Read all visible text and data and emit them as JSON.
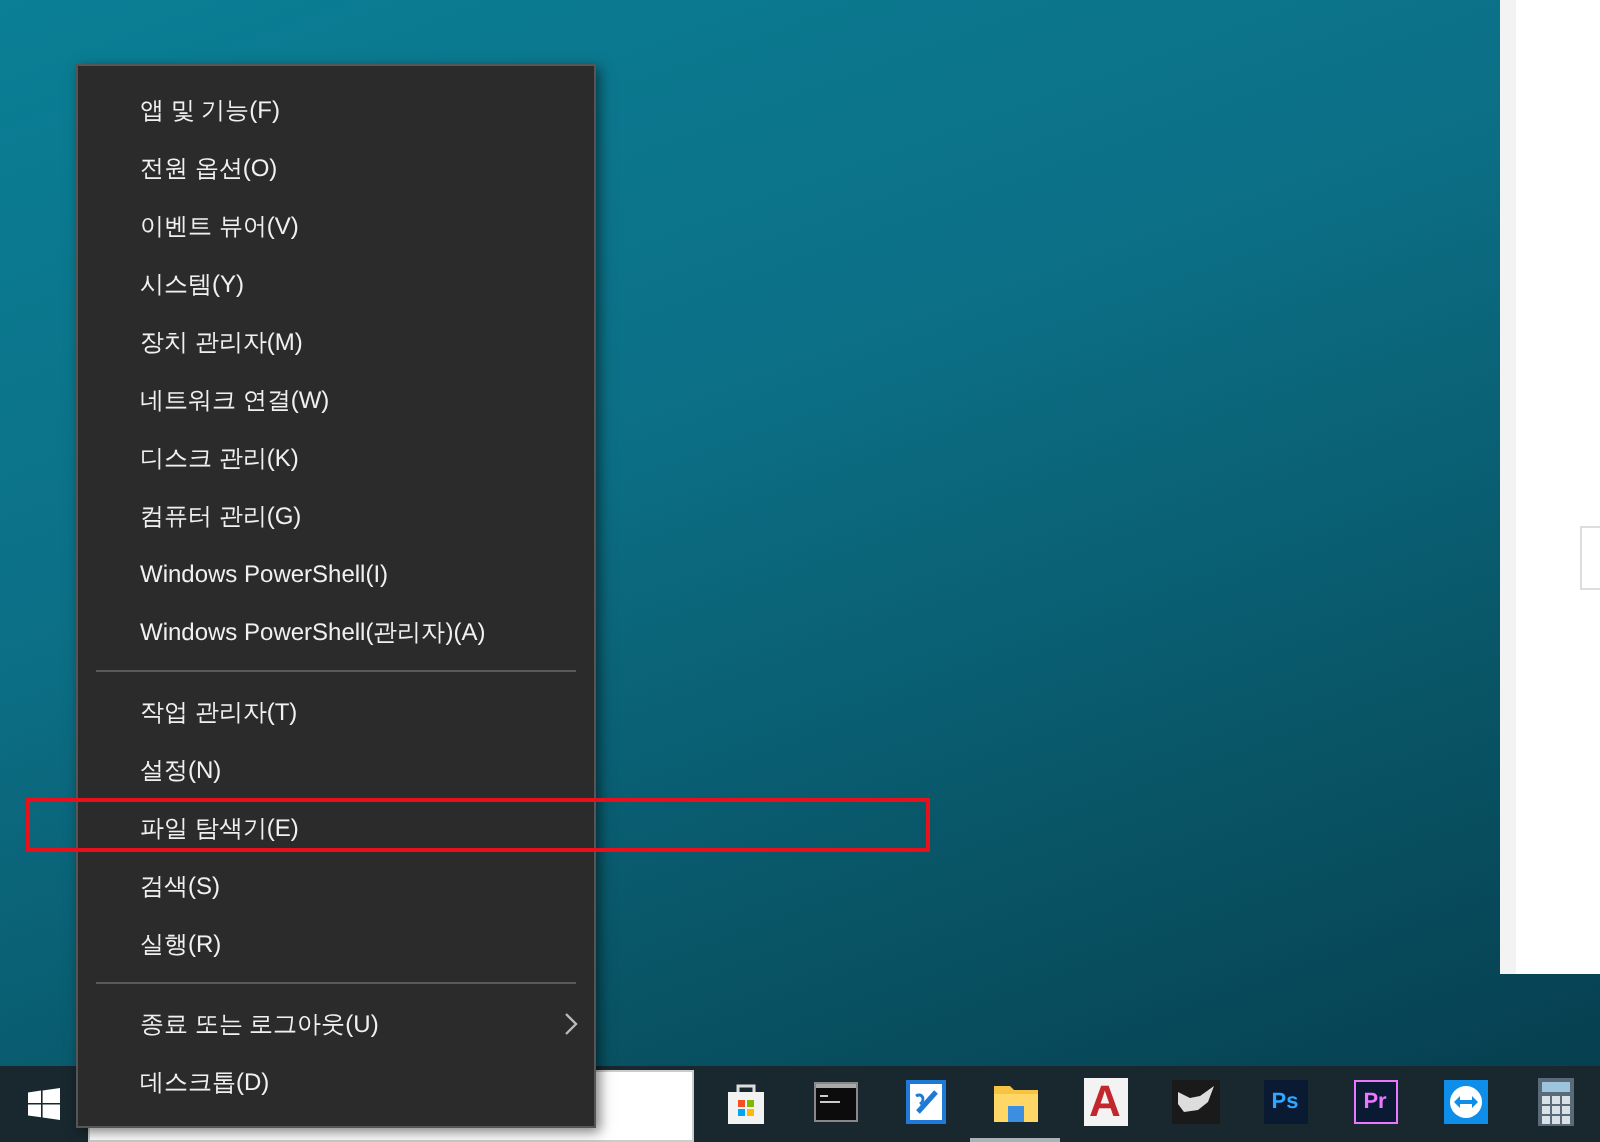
{
  "menu": {
    "groups": [
      {
        "items": [
          {
            "label": "앱 및 기능(F)",
            "submenu": false,
            "annotated": false
          },
          {
            "label": "전원 옵션(O)",
            "submenu": false,
            "annotated": false
          },
          {
            "label": "이벤트 뷰어(V)",
            "submenu": false,
            "annotated": false
          },
          {
            "label": "시스템(Y)",
            "submenu": false,
            "annotated": false
          },
          {
            "label": "장치 관리자(M)",
            "submenu": false,
            "annotated": false
          },
          {
            "label": "네트워크 연결(W)",
            "submenu": false,
            "annotated": false
          },
          {
            "label": "디스크 관리(K)",
            "submenu": false,
            "annotated": false
          },
          {
            "label": "컴퓨터 관리(G)",
            "submenu": false,
            "annotated": false
          },
          {
            "label": "Windows PowerShell(I)",
            "submenu": false,
            "annotated": false
          },
          {
            "label": "Windows PowerShell(관리자)(A)",
            "submenu": false,
            "annotated": false
          }
        ]
      },
      {
        "items": [
          {
            "label": "작업 관리자(T)",
            "submenu": false,
            "annotated": false
          },
          {
            "label": "설정(N)",
            "submenu": false,
            "annotated": false
          },
          {
            "label": "파일 탐색기(E)",
            "submenu": false,
            "annotated": true
          },
          {
            "label": "검색(S)",
            "submenu": false,
            "annotated": false
          },
          {
            "label": "실행(R)",
            "submenu": false,
            "annotated": false
          }
        ]
      },
      {
        "items": [
          {
            "label": "종료 또는 로그아웃(U)",
            "submenu": true,
            "annotated": false
          },
          {
            "label": "데스크톱(D)",
            "submenu": false,
            "annotated": false
          }
        ]
      }
    ]
  },
  "taskbar": {
    "apps": [
      {
        "kind": "store",
        "running": false
      },
      {
        "kind": "terminal",
        "running": false
      },
      {
        "kind": "pen",
        "running": false
      },
      {
        "kind": "folder",
        "running": true
      },
      {
        "kind": "letter",
        "label": "A",
        "color": "#c1272d",
        "running": false
      },
      {
        "kind": "horn",
        "running": false
      },
      {
        "kind": "badge",
        "label": "Ps",
        "color": "#31a8ff",
        "running": false
      },
      {
        "kind": "badge",
        "label": "Pr",
        "color": "#ea77ff",
        "running": false
      },
      {
        "kind": "remote",
        "running": false
      },
      {
        "kind": "calculator",
        "running": false
      }
    ]
  }
}
